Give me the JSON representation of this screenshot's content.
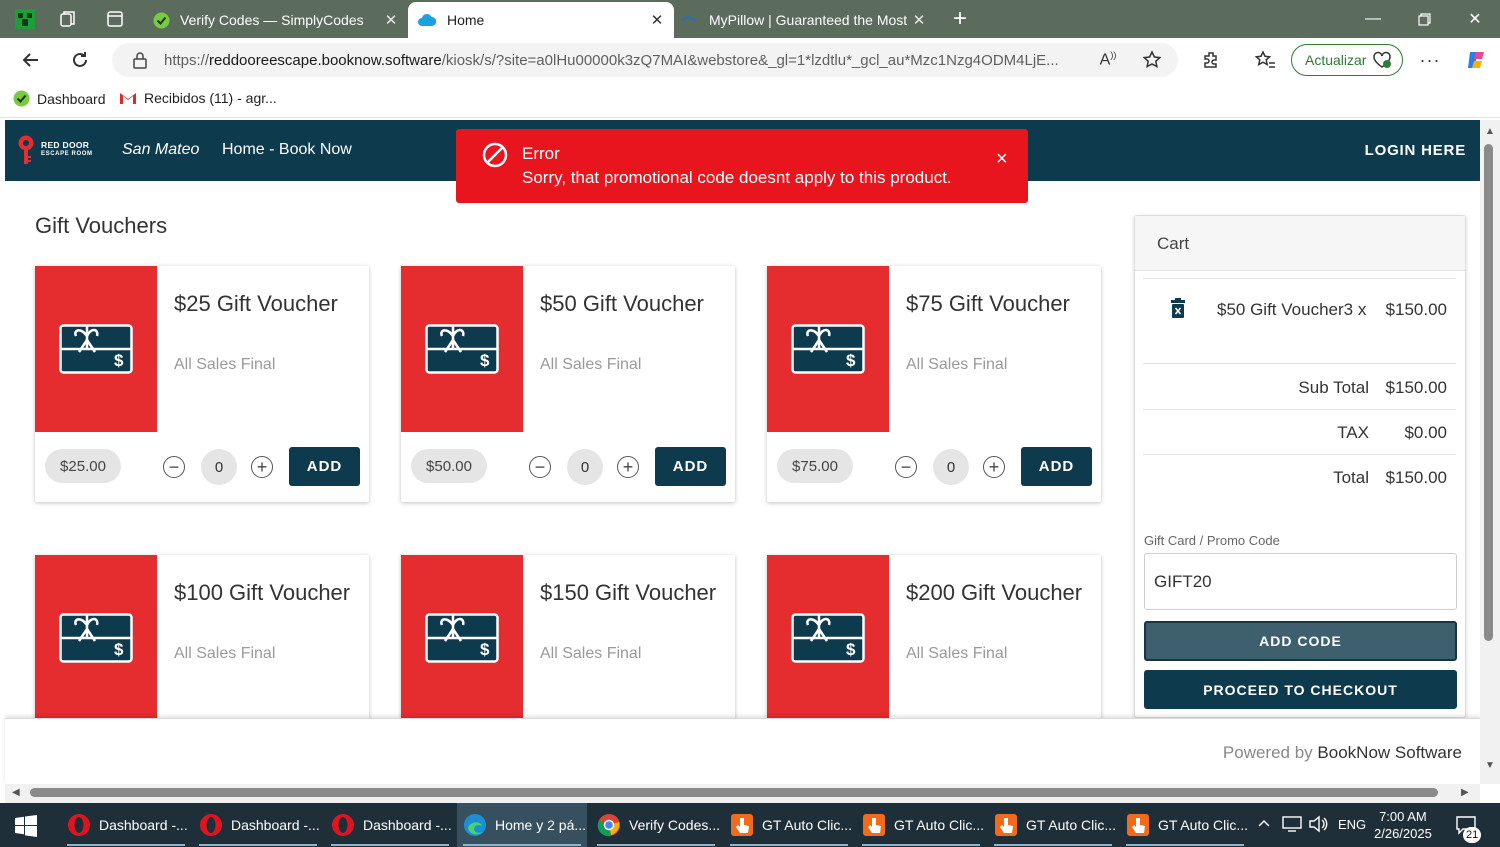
{
  "browser": {
    "tabs": [
      {
        "title": "Verify Codes — SimplyCodes",
        "active": false
      },
      {
        "title": "Home",
        "active": true
      },
      {
        "title": "MyPillow | Guaranteed the Most C",
        "active": false
      }
    ],
    "url_prefix": "https://",
    "url_host": "reddooreescape.booknow.software",
    "url_path": "/kiosk/s/?site=a0lHu00000k3zQ7MAI&webstore&_gl=1*lzdtlu*_gcl_au*Mzc1Nzg4ODM4LjE...",
    "update_label": "Actualizar",
    "bookmarks": [
      {
        "label": "Dashboard"
      },
      {
        "label": "Recibidos (11) - agr..."
      }
    ]
  },
  "site": {
    "logo_line1": "RED DOOR",
    "logo_line2": "ESCAPE ROOM",
    "location": "San Mateo",
    "nav_home": "Home - Book Now",
    "login": "LOGIN HERE"
  },
  "toast": {
    "title": "Error",
    "message": "Sorry, that promotional code doesnt apply to this product.",
    "close": "×"
  },
  "page_title": "Gift Vouchers",
  "vouchers": [
    {
      "name": "$25 Gift Voucher",
      "note": "All Sales Final",
      "price": "$25.00",
      "qty": "0",
      "add": "ADD"
    },
    {
      "name": "$50 Gift Voucher",
      "note": "All Sales Final",
      "price": "$50.00",
      "qty": "0",
      "add": "ADD"
    },
    {
      "name": "$75 Gift Voucher",
      "note": "All Sales Final",
      "price": "$75.00",
      "qty": "0",
      "add": "ADD"
    },
    {
      "name": "$100 Gift Voucher",
      "note": "All Sales Final"
    },
    {
      "name": "$150 Gift Voucher",
      "note": "All Sales Final"
    },
    {
      "name": "$200 Gift Voucher",
      "note": "All Sales Final"
    }
  ],
  "cart": {
    "title": "Cart",
    "item_name": "$50 Gift Voucher3 x",
    "item_price": "$150.00",
    "subtotal_label": "Sub Total",
    "subtotal": "$150.00",
    "tax_label": "TAX",
    "tax": "$0.00",
    "total_label": "Total",
    "total": "$150.00",
    "promo_label": "Gift Card / Promo Code",
    "promo_value": "GIFT20",
    "add_code": "ADD CODE",
    "checkout": "PROCEED TO CHECKOUT"
  },
  "footer": {
    "powered_by": "Powered by",
    "brand": "BookNow Software"
  },
  "taskbar": {
    "apps": [
      {
        "label": "Dashboard -..."
      },
      {
        "label": "Dashboard -..."
      },
      {
        "label": "Dashboard -..."
      },
      {
        "label": "Home y 2 pá..."
      },
      {
        "label": "Verify Codes..."
      },
      {
        "label": "GT Auto Clic..."
      },
      {
        "label": "GT Auto Clic..."
      },
      {
        "label": "GT Auto Clic..."
      },
      {
        "label": "GT Auto Clic..."
      }
    ],
    "lang": "ENG",
    "time": "7:00 AM",
    "date": "2/26/2025",
    "notifications": "21"
  }
}
